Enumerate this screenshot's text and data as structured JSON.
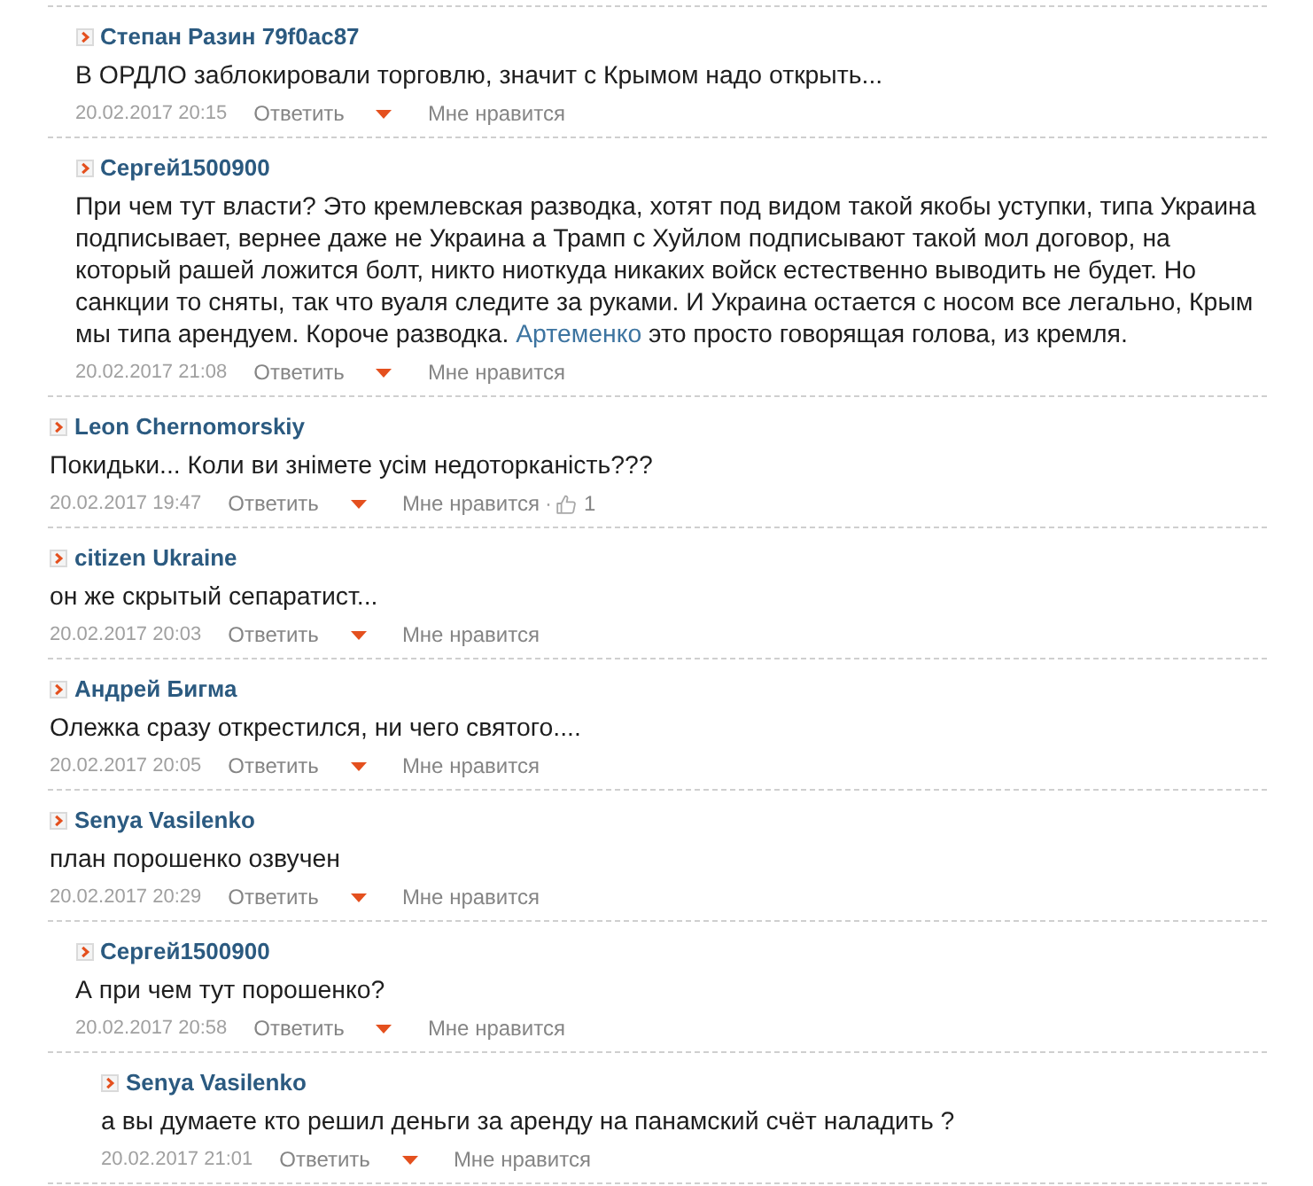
{
  "comments": [
    {
      "children": [
        {
          "author": "Степан Разин 79f0ac87",
          "body": [
            {
              "kind": "text",
              "text": "В ОРДЛО заблокировали торговлю, значит с Крымом надо открыть..."
            }
          ],
          "date": "20.02.2017 20:15",
          "reply": "Ответить",
          "like": "Мне нравится"
        },
        {
          "author": "Сергей1500900",
          "body": [
            {
              "kind": "text",
              "text": "При чем тут власти? Это кремлевская разводка, хотят под видом такой якобы уступки, типа Украина подписывает, вернее даже не Украина а Трамп с Хуйлом подписывают такой мол договор, на который рашей ложится болт, никто ниоткуда никаких войск естественно выводить не будет. Но санкции то сняты, так что вуаля следите за руками. И Украина остается с носом все легально, Крым мы типа арендуем. Короче разводка. "
            },
            {
              "kind": "link",
              "text": "Артеменко"
            },
            {
              "kind": "text",
              "text": " это просто говорящая голова, из кремля."
            }
          ],
          "date": "20.02.2017 21:08",
          "reply": "Ответить",
          "like": "Мне нравится"
        }
      ]
    },
    {
      "author": "Leon Chernomorskiy",
      "body": [
        {
          "kind": "text",
          "text": "Покидьки... Коли ви знімете усім недоторканість???"
        }
      ],
      "date": "20.02.2017 19:47",
      "reply": "Ответить",
      "like": "Мне нравится",
      "likes": {
        "separator": "·",
        "count": "1"
      }
    },
    {
      "author": "citizen Ukraine",
      "body": [
        {
          "kind": "text",
          "text": "он же скрытый сепаратист..."
        }
      ],
      "date": "20.02.2017 20:03",
      "reply": "Ответить",
      "like": "Мне нравится"
    },
    {
      "author": "Андрей Бигма",
      "body": [
        {
          "kind": "text",
          "text": "Олежка сразу открестился, ни чего святого...."
        }
      ],
      "date": "20.02.2017 20:05",
      "reply": "Ответить",
      "like": "Мне нравится"
    },
    {
      "author": "Senya Vasilenko",
      "body": [
        {
          "kind": "text",
          "text": "план порошенко озвучен"
        }
      ],
      "date": "20.02.2017 20:29",
      "reply": "Ответить",
      "like": "Мне нравится",
      "children": [
        {
          "author": "Сергей1500900",
          "body": [
            {
              "kind": "text",
              "text": "А при чем тут порошенко?"
            }
          ],
          "date": "20.02.2017 20:58",
          "reply": "Ответить",
          "like": "Мне нравится",
          "children": [
            {
              "author": "Senya Vasilenko",
              "body": [
                {
                  "kind": "text",
                  "text": "а вы думаете кто решил деньги за аренду на панамский счёт наладить ?"
                }
              ],
              "date": "20.02.2017 21:01",
              "reply": "Ответить",
              "like": "Мне нравится"
            }
          ]
        }
      ]
    }
  ]
}
